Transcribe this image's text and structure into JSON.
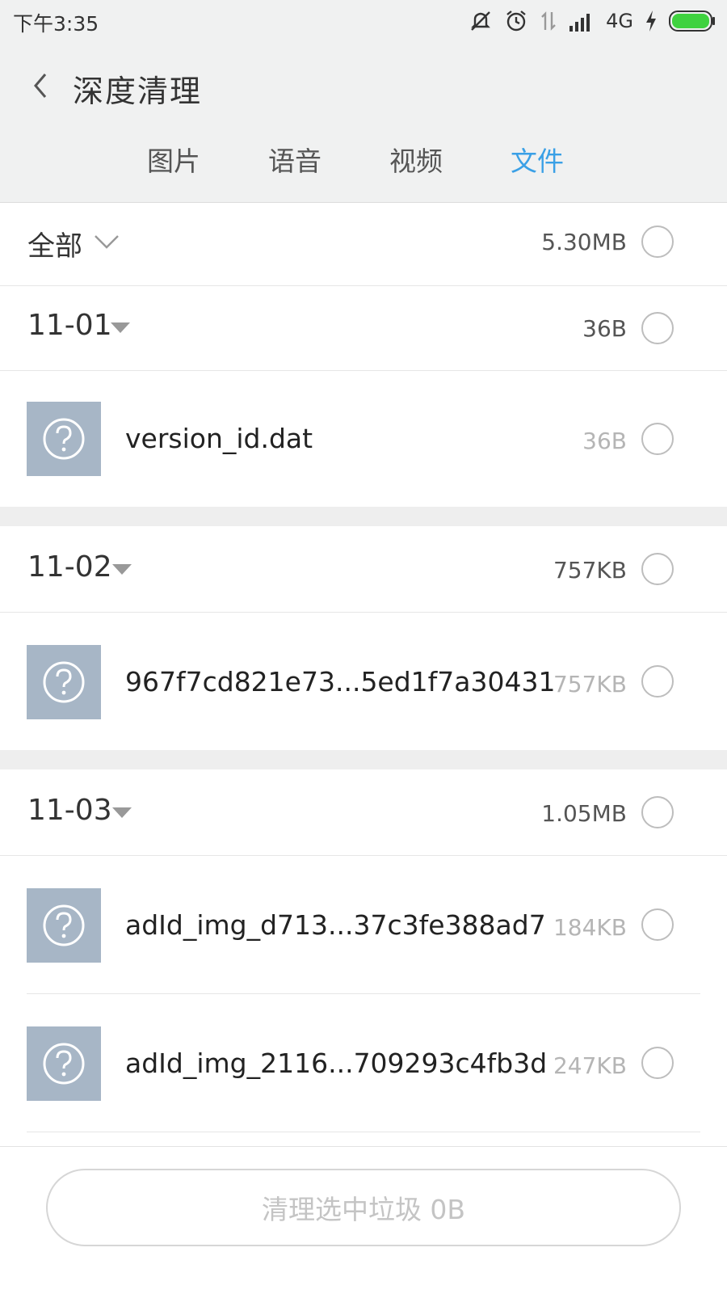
{
  "status": {
    "time": "下午3:35",
    "network": "4G",
    "icons": [
      "mute-icon",
      "alarm-icon",
      "data-icon",
      "signal-icon",
      "charging-icon",
      "battery-icon"
    ]
  },
  "header": {
    "title": "深度清理",
    "back_icon": "back-chevron-icon"
  },
  "tabs": [
    {
      "label": "图片",
      "active": false
    },
    {
      "label": "语音",
      "active": false
    },
    {
      "label": "视频",
      "active": false
    },
    {
      "label": "文件",
      "active": true
    }
  ],
  "all": {
    "label": "全部",
    "size": "5.30MB"
  },
  "groups": [
    {
      "date": "11-01",
      "size": "36B",
      "files": [
        {
          "name": "version_id.dat",
          "size": "36B"
        }
      ]
    },
    {
      "date": "11-02",
      "size": "757KB",
      "files": [
        {
          "name": "967f7cd821e73...5ed1f7a30431",
          "size": "757KB"
        }
      ]
    },
    {
      "date": "11-03",
      "size": "1.05MB",
      "files": [
        {
          "name": "adId_img_d713...37c3fe388ad7",
          "size": "184KB"
        },
        {
          "name": "adId_img_2116...709293c4fb3d",
          "size": "247KB"
        }
      ]
    }
  ],
  "footer": {
    "clean_label": "清理选中垃圾 0B"
  },
  "colors": {
    "accent": "#3aa0e6",
    "icon_bg": "#a7b6c6",
    "header_bg": "#f0f1f1"
  }
}
